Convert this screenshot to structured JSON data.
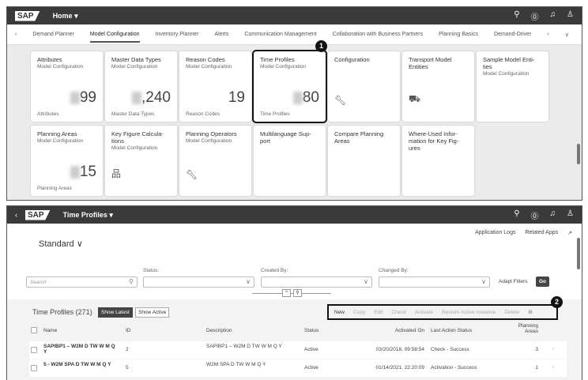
{
  "top": {
    "shell": {
      "logo": "SAP",
      "title": "Home ▾",
      "icons": [
        "search-icon",
        "help-icon",
        "bell-icon",
        "user-icon"
      ]
    },
    "tabs": [
      "Demand Planner",
      "Model Configuration",
      "Inventory Planner",
      "Alerts",
      "Communication Management",
      "Collaboration with Business Partners",
      "Planning Basics",
      "Demand-Driver"
    ],
    "tiles": [
      {
        "title": "Attributes",
        "sub": "Model Configuration",
        "num": "99",
        "foot": "Attributes",
        "blur": true
      },
      {
        "title": "Master Data Types",
        "sub": "Model Configuration",
        "num": ",240",
        "foot": "Master Data Types",
        "blur": true
      },
      {
        "title": "Reason Codes",
        "sub": "Model Configuration",
        "num": "19",
        "foot": "Reason Codes"
      },
      {
        "title": "Time Profiles",
        "sub": "Model Configuration",
        "num": "80",
        "foot": "Time Profiles",
        "blur": true
      },
      {
        "title": "Configuration",
        "icon": "wrench-icon"
      },
      {
        "title": "Transport Model Entities",
        "icon": "transport-icon"
      },
      {
        "title": "Sample Model Enti-ties",
        "sub": "Model Configuration"
      },
      {
        "title": "Planning Areas",
        "sub": "Model Configuration",
        "num": "15",
        "foot": "Planning Areas",
        "blur": true
      },
      {
        "title": "Key Figure Calcula-tions",
        "sub": "Model Configuration",
        "icon": "hierarchy-icon"
      },
      {
        "title": "Planning Operators",
        "sub": "Model Configuration",
        "icon": "wrench-icon"
      },
      {
        "title": "Multilanguage Sup-port"
      },
      {
        "title": "Compare Planning Areas"
      },
      {
        "title": "Where-Used Infor-mation for Key Fig-ures"
      }
    ],
    "callout": "1"
  },
  "bottom": {
    "shell": {
      "logo": "SAP",
      "title": "Time Profiles ▾"
    },
    "links": [
      "Application Logs",
      "Related Apps",
      "↗"
    ],
    "variant": "Standard ∨",
    "filters": {
      "search_placeholder": "Search",
      "status": "Status:",
      "created": "Created By:",
      "changed": "Changed By:",
      "adapt": "Adapt Filters",
      "go": "Go"
    },
    "table": {
      "title": "Time Profiles (271)",
      "show_latest": "Show Latest",
      "show_active": "Show Active",
      "actions": [
        "New",
        "Copy",
        "Edit",
        "Check",
        "Activate",
        "Restore Active Instance",
        "Delete"
      ],
      "callout": "2",
      "columns": [
        "Name",
        "ID",
        "Description",
        "Status",
        "Activated On",
        "Last Action Status",
        "Planning Areas"
      ],
      "rows": [
        {
          "name": "SAPIBP1 – W2M D TW W M Q Y",
          "id": "2",
          "desc": "SAPIBP1 – W2M D TW W M Q Y",
          "status": "Active",
          "activated": "03/20/2018, 09:58:54",
          "last": "Check - Success",
          "areas": "3"
        },
        {
          "name": "5 - W2M SPA D TW W M Q Y",
          "id": "5",
          "desc": "W2M SPA D TW W M Q Y",
          "status": "Active",
          "activated": "01/14/2021, 22:20:09",
          "last": "Activation - Success",
          "areas": "1"
        }
      ]
    }
  }
}
